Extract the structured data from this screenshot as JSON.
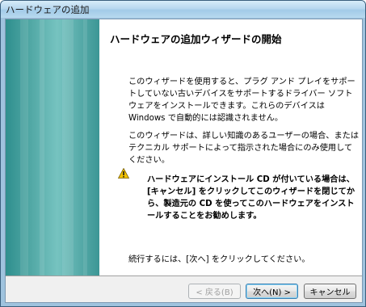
{
  "window": {
    "title": "ハードウェアの追加"
  },
  "wizard": {
    "heading": "ハードウェアの追加ウィザードの開始",
    "intro_lines": [
      "このウィザードを使用すると、プラグ アンド プレイをサポー",
      "トしていない古いデバイスをサポートするドライバー ソフト",
      "ウェアをインストールできます。これらのデバイスは",
      "Windows で自動的には認識されません。"
    ],
    "advanced_lines": [
      "このウィザードは、詳しい知識のあるユーザーの場合、または",
      "テクニカル サポートによって指示された場合にのみ使用して",
      "ください。"
    ],
    "warning_icon": "warning-triangle-icon",
    "warning_lines": [
      "ハードウェアにインストール CD が付いている場合は、",
      "[キャンセル] をクリックしてこのウィザードを閉じてか",
      "ら、製造元の CD を使ってこのハードウェアをインスト",
      "ールすることをお勧めします。"
    ],
    "continue_text": "続行するには、[次へ] をクリックしてください。"
  },
  "buttons": {
    "back": "< 戻る(B)",
    "next": "次へ(N) >",
    "cancel": "キャンセル"
  },
  "colors": {
    "side_panel": "#4ea7a5",
    "titlebar": "#b8d8ef",
    "warning": "#f2c200"
  }
}
